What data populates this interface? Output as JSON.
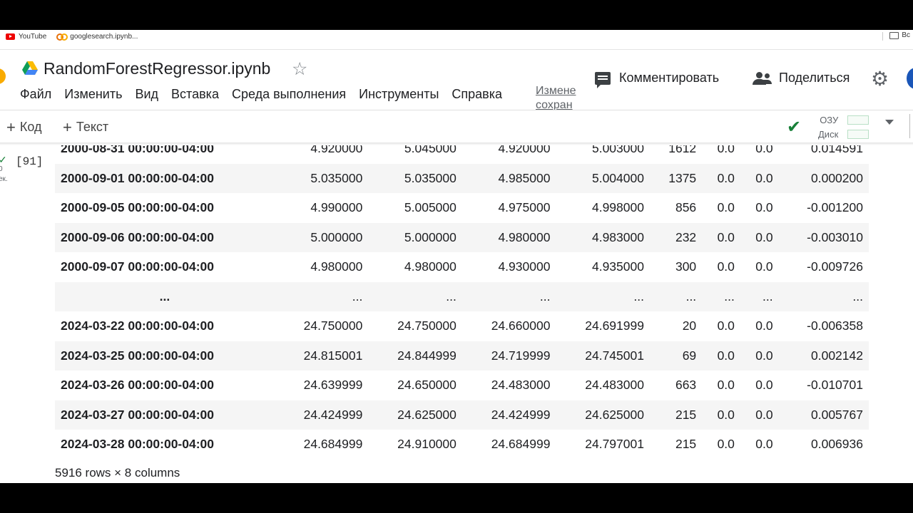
{
  "bookmarks": [
    {
      "label": "YouTube",
      "icon": "youtube-icon"
    },
    {
      "label": "googlesearch.ipynb...",
      "icon": "colab-icon"
    }
  ],
  "bookmarks_right": "Вс",
  "notebook": {
    "title": "RandomForestRegressor.ipynb",
    "menu": [
      "Файл",
      "Изменить",
      "Вид",
      "Вставка",
      "Среда выполнения",
      "Инструменты",
      "Справка"
    ],
    "saved_status_line1": "Измене",
    "saved_status_line2": "сохран"
  },
  "header": {
    "comment_label": "Комментировать",
    "share_label": "Поделиться"
  },
  "toolbar": {
    "add_code": "Код",
    "add_text": "Текст",
    "ram_label": "ОЗУ",
    "disk_label": "Диск"
  },
  "cell": {
    "execution_count": "[91]",
    "gutter_line1": "0",
    "gutter_line2": "ек."
  },
  "dataframe": {
    "rows": [
      [
        "2000-08-31 00:00:00-04:00",
        "4.920000",
        "5.045000",
        "4.920000",
        "5.003000",
        "1612",
        "0.0",
        "0.0",
        "0.014591"
      ],
      [
        "2000-09-01 00:00:00-04:00",
        "5.035000",
        "5.035000",
        "4.985000",
        "5.004000",
        "1375",
        "0.0",
        "0.0",
        "0.000200"
      ],
      [
        "2000-09-05 00:00:00-04:00",
        "4.990000",
        "5.005000",
        "4.975000",
        "4.998000",
        "856",
        "0.0",
        "0.0",
        "-0.001200"
      ],
      [
        "2000-09-06 00:00:00-04:00",
        "5.000000",
        "5.000000",
        "4.980000",
        "4.983000",
        "232",
        "0.0",
        "0.0",
        "-0.003010"
      ],
      [
        "2000-09-07 00:00:00-04:00",
        "4.980000",
        "4.980000",
        "4.930000",
        "4.935000",
        "300",
        "0.0",
        "0.0",
        "-0.009726"
      ],
      [
        "...",
        "...",
        "...",
        "...",
        "...",
        "...",
        "...",
        "...",
        "..."
      ],
      [
        "2024-03-22 00:00:00-04:00",
        "24.750000",
        "24.750000",
        "24.660000",
        "24.691999",
        "20",
        "0.0",
        "0.0",
        "-0.006358"
      ],
      [
        "2024-03-25 00:00:00-04:00",
        "24.815001",
        "24.844999",
        "24.719999",
        "24.745001",
        "69",
        "0.0",
        "0.0",
        "0.002142"
      ],
      [
        "2024-03-26 00:00:00-04:00",
        "24.639999",
        "24.650000",
        "24.483000",
        "24.483000",
        "663",
        "0.0",
        "0.0",
        "-0.010701"
      ],
      [
        "2024-03-27 00:00:00-04:00",
        "24.424999",
        "24.625000",
        "24.424999",
        "24.625000",
        "215",
        "0.0",
        "0.0",
        "0.005767"
      ],
      [
        "2024-03-28 00:00:00-04:00",
        "24.684999",
        "24.910000",
        "24.684999",
        "24.797001",
        "215",
        "0.0",
        "0.0",
        "0.006936"
      ]
    ],
    "shape_label": "5916 rows × 8 columns"
  }
}
